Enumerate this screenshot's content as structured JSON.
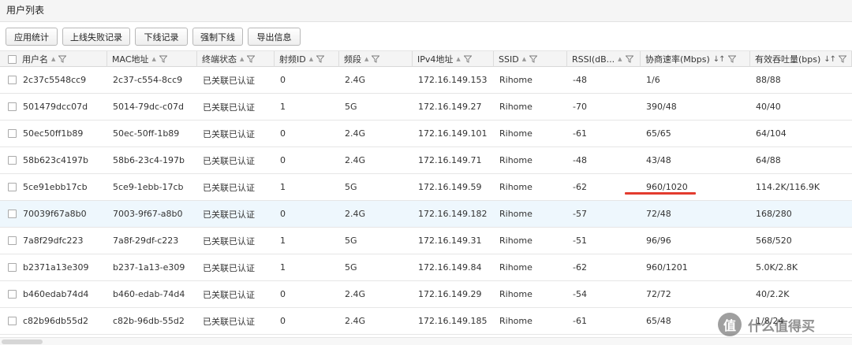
{
  "page_title": "用户列表",
  "toolbar": {
    "buttons": [
      "应用统计",
      "上线失败记录",
      "下线记录",
      "强制下线",
      "导出信息"
    ]
  },
  "columns": [
    {
      "label": "用户名",
      "sort": "single"
    },
    {
      "label": "MAC地址",
      "sort": "single"
    },
    {
      "label": "终端状态",
      "sort": "single"
    },
    {
      "label": "射频ID",
      "sort": "single"
    },
    {
      "label": "频段",
      "sort": "single"
    },
    {
      "label": "IPv4地址",
      "sort": "single"
    },
    {
      "label": "SSID",
      "sort": "single"
    },
    {
      "label": "RSSI(dB...",
      "sort": "single"
    },
    {
      "label": "协商速率(Mbps)",
      "sort": "double",
      "sort_label": "↓↑"
    },
    {
      "label": "有效吞吐量(bps)",
      "sort": "double",
      "sort_label": "↓↑"
    }
  ],
  "rows": [
    [
      "2c37c5548cc9",
      "2c37-c554-8cc9",
      "已关联已认证",
      "0",
      "2.4G",
      "172.16.149.153",
      "Rihome",
      "-48",
      "1/6",
      "88/88"
    ],
    [
      "501479dcc07d",
      "5014-79dc-c07d",
      "已关联已认证",
      "1",
      "5G",
      "172.16.149.27",
      "Rihome",
      "-70",
      "390/48",
      "40/40"
    ],
    [
      "50ec50ff1b89",
      "50ec-50ff-1b89",
      "已关联已认证",
      "0",
      "2.4G",
      "172.16.149.101",
      "Rihome",
      "-61",
      "65/65",
      "64/104"
    ],
    [
      "58b623c4197b",
      "58b6-23c4-197b",
      "已关联已认证",
      "0",
      "2.4G",
      "172.16.149.71",
      "Rihome",
      "-48",
      "43/48",
      "64/88"
    ],
    [
      "5ce91ebb17cb",
      "5ce9-1ebb-17cb",
      "已关联已认证",
      "1",
      "5G",
      "172.16.149.59",
      "Rihome",
      "-62",
      "960/1020",
      "114.2K/116.9K"
    ],
    [
      "70039f67a8b0",
      "7003-9f67-a8b0",
      "已关联已认证",
      "0",
      "2.4G",
      "172.16.149.182",
      "Rihome",
      "-57",
      "72/48",
      "168/280"
    ],
    [
      "7a8f29dfc223",
      "7a8f-29df-c223",
      "已关联已认证",
      "1",
      "5G",
      "172.16.149.31",
      "Rihome",
      "-51",
      "96/96",
      "568/520"
    ],
    [
      "b2371a13e309",
      "b237-1a13-e309",
      "已关联已认证",
      "1",
      "5G",
      "172.16.149.84",
      "Rihome",
      "-62",
      "960/1201",
      "5.0K/2.8K"
    ],
    [
      "b460edab74d4",
      "b460-edab-74d4",
      "已关联已认证",
      "0",
      "2.4G",
      "172.16.149.29",
      "Rihome",
      "-54",
      "72/72",
      "40/2.2K"
    ],
    [
      "c82b96db55d2",
      "c82b-96db-55d2",
      "已关联已认证",
      "0",
      "2.4G",
      "172.16.149.185",
      "Rihome",
      "-61",
      "65/48",
      "1/8/24"
    ]
  ],
  "highlighted_row": 5,
  "colors": {
    "highlight_row": "#eef7fd",
    "annotation_underline": "#e33b2e"
  },
  "watermark": {
    "logo": "值",
    "text": "什么值得买"
  }
}
